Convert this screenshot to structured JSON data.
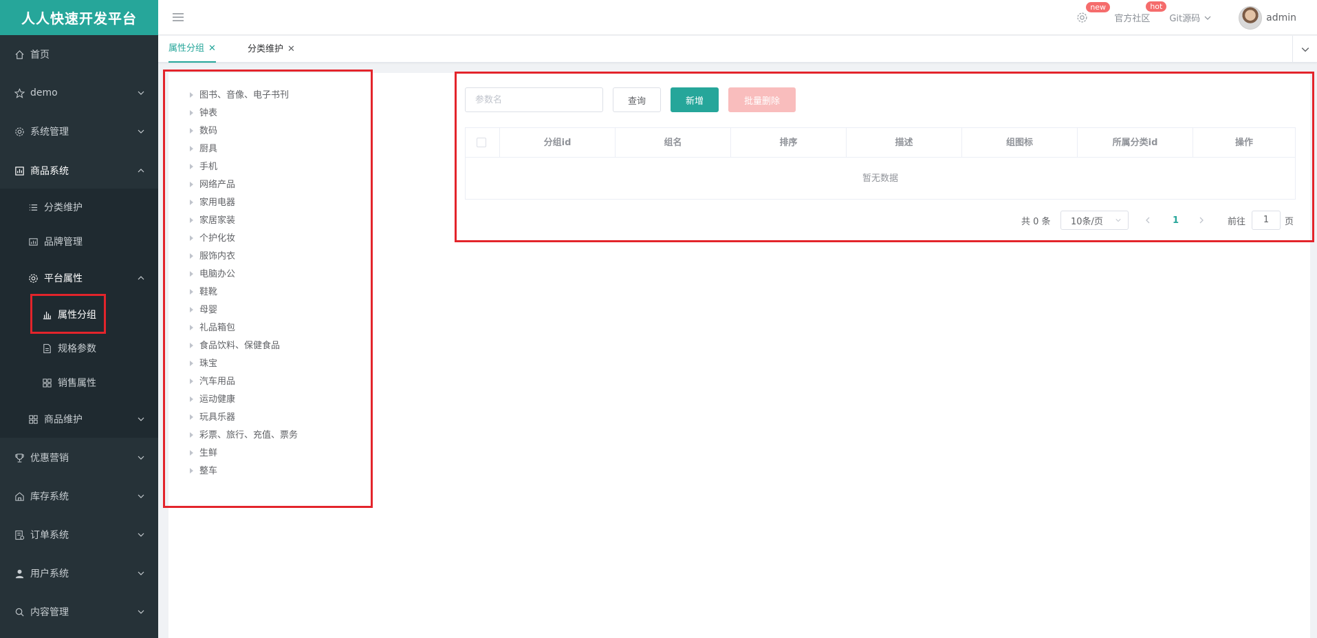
{
  "brand": "人人快速开发平台",
  "sidebar": {
    "items": [
      {
        "label": "首页",
        "icon": "home-icon"
      },
      {
        "label": "demo",
        "icon": "star-icon"
      },
      {
        "label": "系统管理",
        "icon": "gear-icon"
      },
      {
        "label": "商品系统",
        "icon": "product-icon"
      },
      {
        "label": "分类维护",
        "icon": "list-icon"
      },
      {
        "label": "品牌管理",
        "icon": "brand-icon"
      },
      {
        "label": "平台属性",
        "icon": "gear-icon"
      },
      {
        "label": "属性分组",
        "icon": "bar-chart-icon"
      },
      {
        "label": "规格参数",
        "icon": "document-icon"
      },
      {
        "label": "销售属性",
        "icon": "grid-icon"
      },
      {
        "label": "商品维护",
        "icon": "grid-icon"
      },
      {
        "label": "优惠营销",
        "icon": "trophy-icon"
      },
      {
        "label": "库存系统",
        "icon": "warehouse-icon"
      },
      {
        "label": "订单系统",
        "icon": "order-icon"
      },
      {
        "label": "用户系统",
        "icon": "user-icon"
      },
      {
        "label": "内容管理",
        "icon": "search-icon"
      }
    ]
  },
  "header": {
    "badge_new": "new",
    "community": "官方社区",
    "badge_hot": "hot",
    "git": "Git源码",
    "user": "admin"
  },
  "tabs": [
    {
      "label": "属性分组",
      "active": true
    },
    {
      "label": "分类维护",
      "active": false
    }
  ],
  "tree": [
    "图书、音像、电子书刊",
    "钟表",
    "数码",
    "厨具",
    "手机",
    "网络产品",
    "家用电器",
    "家居家装",
    "个护化妆",
    "服饰内衣",
    "电脑办公",
    "鞋靴",
    "母婴",
    "礼品箱包",
    "食品饮料、保健食品",
    "珠宝",
    "汽车用品",
    "运动健康",
    "玩具乐器",
    "彩票、旅行、充值、票务",
    "生鲜",
    "整车"
  ],
  "toolbar": {
    "search_placeholder": "参数名",
    "query_label": "查询",
    "add_label": "新增",
    "batch_delete_label": "批量删除"
  },
  "table": {
    "columns": [
      "分组id",
      "组名",
      "排序",
      "描述",
      "组图标",
      "所属分类id",
      "操作"
    ],
    "empty_text": "暂无数据"
  },
  "pagination": {
    "total_text": "共 0 条",
    "page_size": "10条/页",
    "current_page": "1",
    "goto_prefix": "前往",
    "goto_value": "1",
    "goto_suffix": "页"
  },
  "colors": {
    "accent": "#26a69a",
    "sidebar_bg": "#263238",
    "highlight": "#e3242b",
    "danger_disabled": "#f9bdbd"
  }
}
